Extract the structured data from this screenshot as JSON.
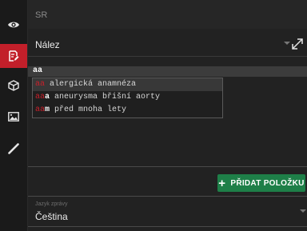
{
  "sidebar": {
    "tools": [
      {
        "icon": "eye-icon",
        "active": false
      },
      {
        "icon": "report-edit-icon",
        "active": true
      },
      {
        "icon": "cube-icon",
        "active": false
      },
      {
        "icon": "image-icon",
        "active": false
      },
      {
        "icon": "measure-icon",
        "active": false
      }
    ],
    "active_color": "#c21f2a"
  },
  "header": {
    "title": "SR"
  },
  "field": {
    "label": "Nález"
  },
  "input": {
    "value": "aa"
  },
  "suggestions": [
    {
      "match": "aa",
      "rest": " alergická anamnéza",
      "highlighted": true
    },
    {
      "match": "aa",
      "bold": "a",
      "rest": " aneurysma břišní aorty",
      "highlighted": false
    },
    {
      "match": "aa",
      "bold": "m",
      "rest": " před mnoha lety",
      "highlighted": false
    }
  ],
  "actions": {
    "add_label": "PŘIDAT POLOŽKU",
    "add_color": "#1e7f48"
  },
  "language": {
    "label": "Jazyk zprávy",
    "value": "Čeština"
  }
}
